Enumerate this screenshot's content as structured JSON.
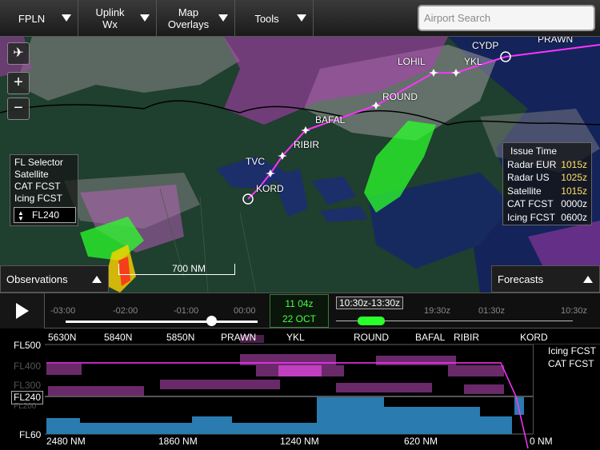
{
  "toolbar": {
    "fpln_label": "FPLN",
    "uplink_label_1": "Uplink",
    "uplink_label_2": "Wx",
    "map_overlays_label_1": "Map",
    "map_overlays_label_2": "Overlays",
    "tools_label": "Tools",
    "search_placeholder": "Airport Search"
  },
  "map": {
    "waypoints": [
      "CYDP",
      "PRAWN",
      "LOHIL",
      "YKL",
      "ROUND",
      "BAFAL",
      "RIBIR",
      "TVC",
      "KORD"
    ],
    "scale_label": "700 NM",
    "fl_panel": {
      "title": "FL Selector",
      "items": [
        "Satellite",
        "CAT FCST",
        "Icing FCST"
      ],
      "selected_level": "FL240"
    },
    "issue_time": {
      "title": "Issue Time",
      "rows": [
        {
          "label": "Radar EUR",
          "time": "1015z"
        },
        {
          "label": "Radar US",
          "time": "1025z"
        },
        {
          "label": "Satellite",
          "time": "1015z"
        },
        {
          "label": "CAT FCST",
          "time": "0000z"
        },
        {
          "label": "Icing FCST",
          "time": "0600z"
        }
      ]
    },
    "observations_label": "Observations",
    "forecasts_label": "Forecasts"
  },
  "timeline": {
    "obs_ticks": [
      "-03:00",
      "-02:00",
      "-01:00",
      "00:00"
    ],
    "clock_time": "11 04z",
    "clock_date": "22 OCT",
    "forecast_range": "10:30z-13:30z",
    "fc_ticks": [
      "19:30z",
      "01:30z",
      "10:30z"
    ]
  },
  "profile": {
    "levels": [
      "FL500",
      "FL400",
      "FL300",
      "FL240",
      "FL200",
      "FL60"
    ],
    "waypoints": [
      "5630N",
      "5840N",
      "5850N",
      "PRAWN",
      "YKL",
      "ROUND",
      "BAFAL",
      "RIBIR",
      "KORD"
    ],
    "distances": [
      "2480 NM",
      "1860 NM",
      "1240 NM",
      "620 NM",
      "0 NM"
    ],
    "legend": [
      "Icing FCST",
      "CAT FCST"
    ]
  },
  "colors": {
    "route": "#ff33ff",
    "radar_green": "#2bff2b",
    "icing": "#9b3d9b",
    "cat": "#2a8cc8",
    "issue_time_highlight": "#ffe066"
  }
}
